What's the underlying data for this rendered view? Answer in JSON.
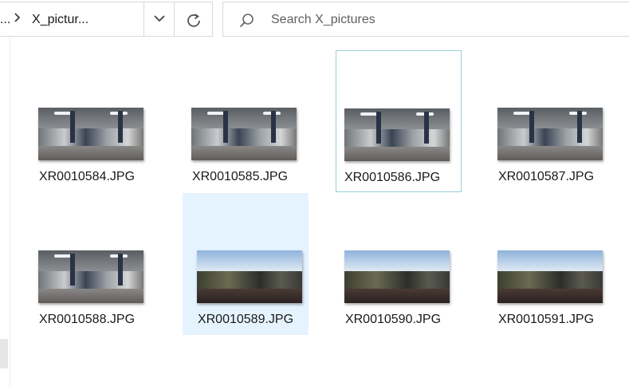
{
  "address_bar": {
    "overflow_glyph": "...",
    "separator": ">",
    "current_folder": "X_pictur..."
  },
  "search": {
    "placeholder": "Search X_pictures"
  },
  "files": [
    {
      "name": "XR0010584.JPG",
      "selected": false,
      "focused": false,
      "scene": "indoor"
    },
    {
      "name": "XR0010585.JPG",
      "selected": false,
      "focused": false,
      "scene": "indoor"
    },
    {
      "name": "XR0010586.JPG",
      "selected": false,
      "focused": true,
      "scene": "indoor"
    },
    {
      "name": "XR0010587.JPG",
      "selected": false,
      "focused": false,
      "scene": "indoor"
    },
    {
      "name": "XR0010588.JPG",
      "selected": false,
      "focused": false,
      "scene": "indoor"
    },
    {
      "name": "XR0010589.JPG",
      "selected": true,
      "focused": false,
      "scene": "outdoor"
    },
    {
      "name": "XR0010590.JPG",
      "selected": false,
      "focused": false,
      "scene": "outdoor"
    },
    {
      "name": "XR0010591.JPG",
      "selected": false,
      "focused": false,
      "scene": "outdoor"
    }
  ],
  "colors": {
    "selection": "#e5f3ff",
    "focus_border": "#99d1d9",
    "border": "#d9d9d9"
  }
}
